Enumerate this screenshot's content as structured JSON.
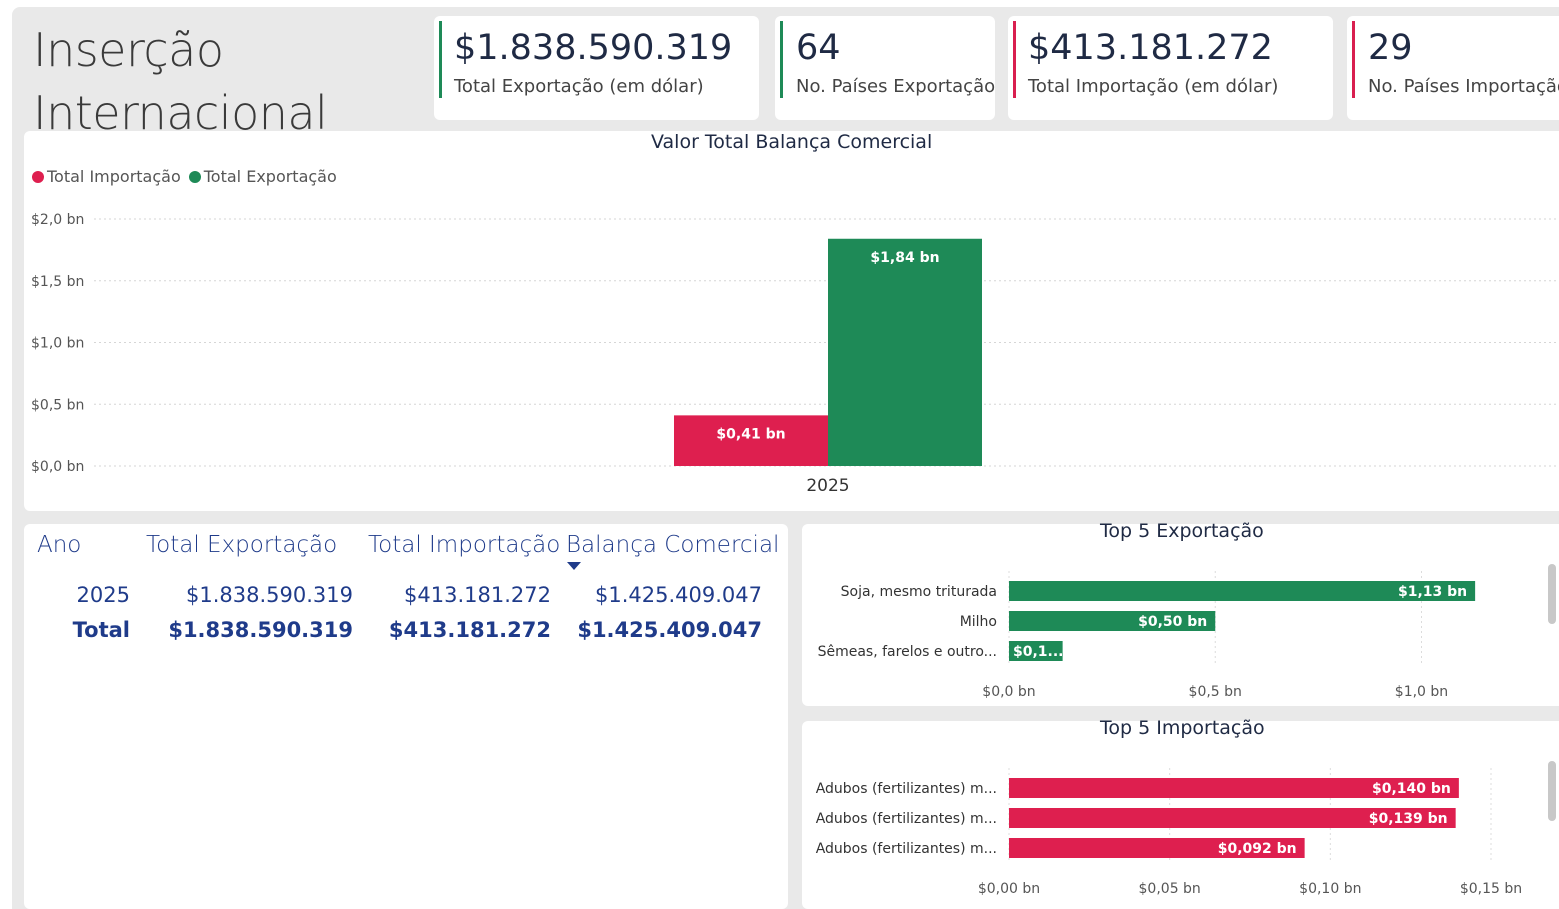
{
  "page": {
    "title_line1": "Inserção",
    "title_line2": "Internacional"
  },
  "kpis": [
    {
      "value": "$1.838.590.319",
      "label": "Total Exportação (em dólar)",
      "color": "#1e8a57"
    },
    {
      "value": "64",
      "label": "No. Países Exportação",
      "color": "#1e8a57"
    },
    {
      "value": "$413.181.272",
      "label": "Total Importação (em dólar)",
      "color": "#d91f4f"
    },
    {
      "value": "29",
      "label": "No. Países Importação",
      "color": "#d91f4f"
    }
  ],
  "colors": {
    "import": "#de1f4f",
    "export": "#1e8a57",
    "text": "#1f2a44",
    "table_text": "#1f3b8a"
  },
  "main_chart": {
    "title": "Valor Total Balança Comercial",
    "legend": [
      "Total Importação",
      "Total Exportação"
    ]
  },
  "table": {
    "headers": [
      "Ano",
      "Total Exportação",
      "Total Importação",
      "Balança Comercial"
    ],
    "rows": [
      [
        "2025",
        "$1.838.590.319",
        "$413.181.272",
        "$1.425.409.047"
      ]
    ],
    "total": [
      "Total",
      "$1.838.590.319",
      "$413.181.272",
      "$1.425.409.047"
    ]
  },
  "top_export": {
    "title": "Top 5 Exportação"
  },
  "top_import": {
    "title": "Top 5 Importação"
  },
  "chart_data": [
    {
      "type": "bar",
      "title": "Valor Total Balança Comercial",
      "categories": [
        "2025"
      ],
      "series": [
        {
          "name": "Total Importação",
          "values": [
            0.41
          ],
          "labels": [
            "$0,41 bn"
          ],
          "color": "#de1f4f"
        },
        {
          "name": "Total Exportação",
          "values": [
            1.84
          ],
          "labels": [
            "$1,84 bn"
          ],
          "color": "#1e8a57"
        }
      ],
      "ylim": [
        0,
        2.0
      ],
      "yticks": [
        0,
        0.5,
        1.0,
        1.5,
        2.0
      ],
      "ytick_labels": [
        "$0,0 bn",
        "$0,5 bn",
        "$1,0 bn",
        "$1,5 bn",
        "$2,0 bn"
      ],
      "grid": true,
      "legend_position": "top-left"
    },
    {
      "type": "bar",
      "orientation": "horizontal",
      "title": "Top 5 Exportação",
      "categories": [
        "Soja, mesmo triturada",
        "Milho",
        "Sêmeas, farelos e outro..."
      ],
      "values": [
        1.13,
        0.5,
        0.13
      ],
      "labels": [
        "$1,13 bn",
        "$0,50 bn",
        "$0,1..."
      ],
      "xlim": [
        0,
        1.2
      ],
      "xticks": [
        0,
        0.5,
        1.0
      ],
      "xtick_labels": [
        "$0,0 bn",
        "$0,5 bn",
        "$1,0 bn"
      ],
      "color": "#1e8a57"
    },
    {
      "type": "bar",
      "orientation": "horizontal",
      "title": "Top 5 Importação",
      "categories": [
        "Adubos (fertilizantes) m...",
        "Adubos (fertilizantes) m...",
        "Adubos (fertilizantes) m..."
      ],
      "values": [
        0.14,
        0.139,
        0.092
      ],
      "labels": [
        "$0,140 bn",
        "$0,139 bn",
        "$0,092 bn"
      ],
      "xlim": [
        0,
        0.15
      ],
      "xticks": [
        0,
        0.05,
        0.1,
        0.15
      ],
      "xtick_labels": [
        "$0,00 bn",
        "$0,05 bn",
        "$0,10 bn",
        "$0,15 bn"
      ],
      "color": "#de1f4f"
    }
  ]
}
